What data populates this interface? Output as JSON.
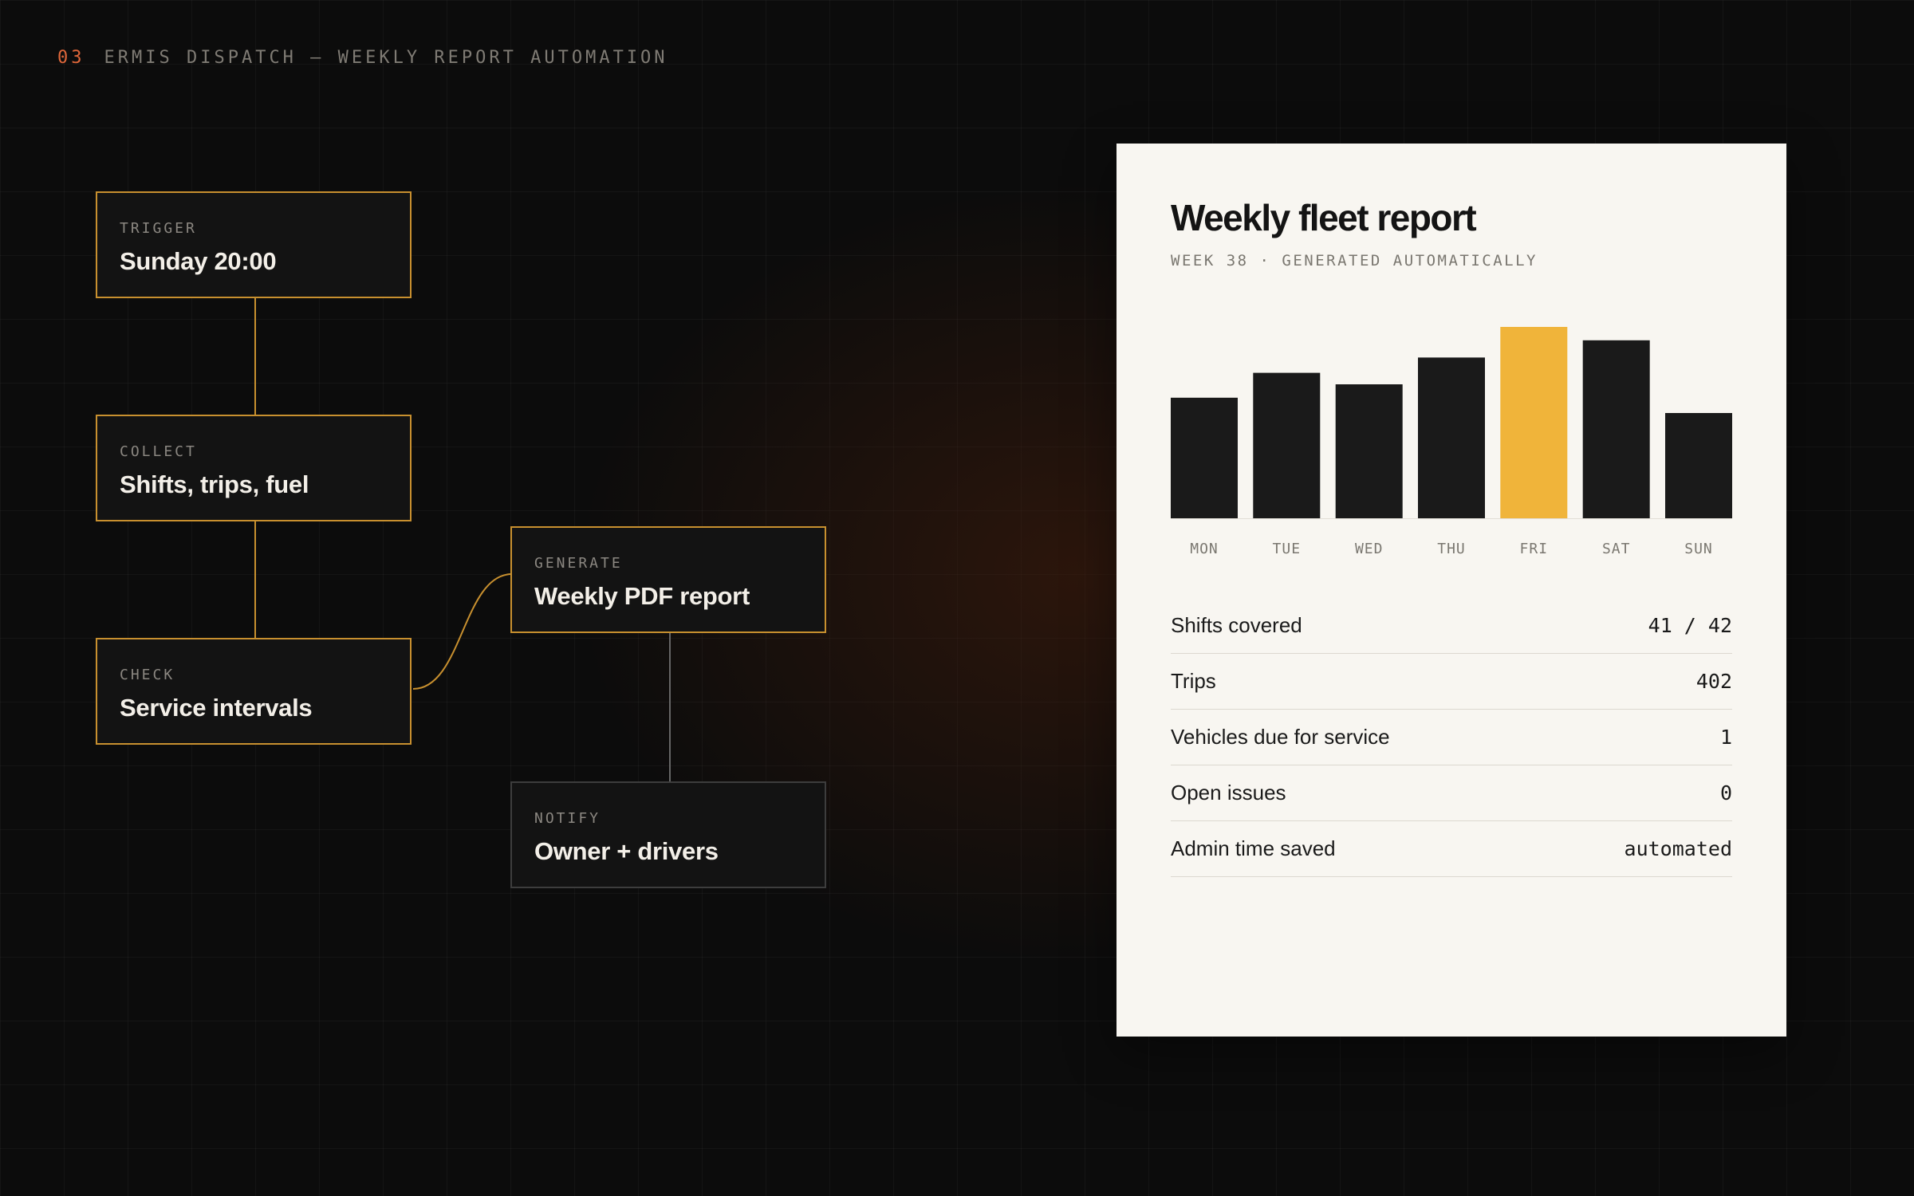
{
  "header": {
    "number": "03",
    "title": "ERMIS DISPATCH — WEEKLY REPORT AUTOMATION"
  },
  "colors": {
    "accent": "#c8902f",
    "highlight": "#f0b43a",
    "muted_border": "#3d3d3d",
    "page_background": "#0c0c0c",
    "card_background": "#f8f6f1"
  },
  "flow": {
    "nodes": [
      {
        "id": "trigger",
        "kicker": "TRIGGER",
        "title": "Sunday 20:00"
      },
      {
        "id": "collect",
        "kicker": "COLLECT",
        "title": "Shifts, trips, fuel"
      },
      {
        "id": "check",
        "kicker": "CHECK",
        "title": "Service intervals"
      },
      {
        "id": "generate",
        "kicker": "GENERATE",
        "title": "Weekly PDF report"
      },
      {
        "id": "notify",
        "kicker": "NOTIFY",
        "title": "Owner + drivers"
      }
    ],
    "edges": [
      {
        "from": "trigger",
        "to": "collect"
      },
      {
        "from": "collect",
        "to": "check"
      },
      {
        "from": "check",
        "to": "generate"
      },
      {
        "from": "generate",
        "to": "notify"
      }
    ]
  },
  "report": {
    "title": "Weekly fleet report",
    "subtitle": "WEEK 38 · GENERATED AUTOMATICALLY",
    "stats": [
      {
        "label": "Shifts covered",
        "value": "41 / 42"
      },
      {
        "label": "Trips",
        "value": "402"
      },
      {
        "label": "Vehicles due for service",
        "value": "1"
      },
      {
        "label": "Open issues",
        "value": "0"
      },
      {
        "label": "Admin time saved",
        "value": "automated"
      }
    ]
  },
  "chart_data": {
    "type": "bar",
    "categories": [
      "MON",
      "TUE",
      "WED",
      "THU",
      "FRI",
      "SAT",
      "SUN"
    ],
    "values": [
      63,
      76,
      70,
      84,
      100,
      93,
      55
    ],
    "highlight_category": "FRI",
    "ylim": [
      0,
      100
    ],
    "grid": false,
    "legend": "none",
    "bar_color": "#1a1a1a",
    "highlight_color": "#f0b43a"
  }
}
